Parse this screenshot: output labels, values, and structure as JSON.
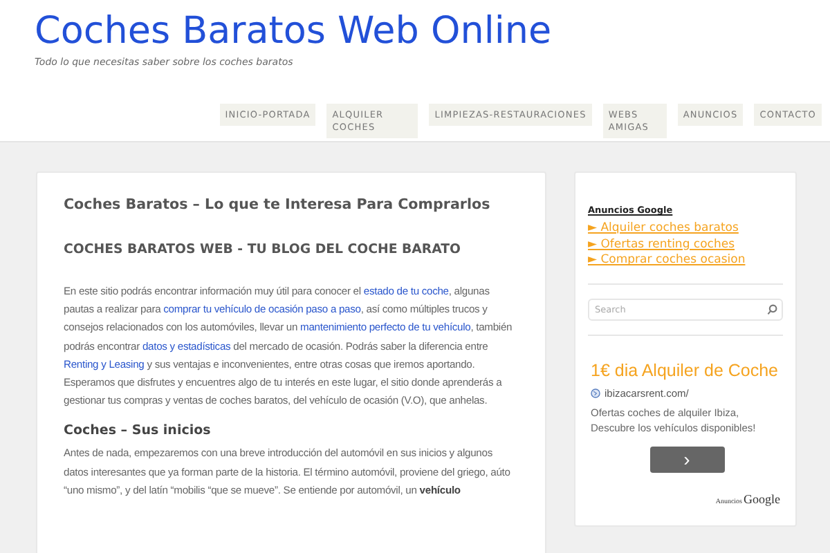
{
  "site": {
    "title": "Coches Baratos Web Online",
    "tagline": "Todo lo que necesitas saber sobre los coches baratos"
  },
  "nav": {
    "items": [
      {
        "label": "INICIO-PORTADA"
      },
      {
        "label": "ALQUILER COCHES"
      },
      {
        "label": "LIMPIEZAS-RESTAURACIONES"
      },
      {
        "label": "WEBS AMIGAS"
      },
      {
        "label": "ANUNCIOS"
      },
      {
        "label": "CONTACTO"
      }
    ]
  },
  "post": {
    "title": "Coches Baratos – Lo que te Interesa Para Comprarlos",
    "blocks": [
      {
        "kind": "heading",
        "text": "COCHES BARATOS WEB - TU BLOG DEL COCHE BARATO"
      },
      {
        "kind": "paragraph",
        "segments": [
          {
            "kind": "text",
            "text": "En este sitio podrás encontrar información muy útil para conocer el "
          },
          {
            "kind": "link",
            "text": "estado de tu coche"
          },
          {
            "kind": "text",
            "text": ", algunas pautas a realizar para "
          },
          {
            "kind": "link",
            "text": "comprar tu vehículo de ocasión paso a paso"
          },
          {
            "kind": "text",
            "text": ", así como múltiples trucos y consejos relacionados con los automóviles, llevar un "
          },
          {
            "kind": "link",
            "text": "mantenimiento perfecto de tu vehículo"
          },
          {
            "kind": "text",
            "text": ", también podrás encontrar "
          },
          {
            "kind": "link",
            "text": "datos y estadísticas"
          },
          {
            "kind": "text",
            "text": " del mercado de ocasión. Podrás saber la diferencia entre "
          },
          {
            "kind": "link",
            "text": "Renting y Leasing"
          },
          {
            "kind": "text",
            "text": " y sus ventajas e inconvenientes, entre otras cosas que iremos aportando. Esperamos que disfrutes y encuentres algo de tu interés en este lugar, el sitio donde aprenderás a gestionar tus compras y ventas de coches baratos, del vehículo de ocasión (V.O), que anhelas."
          }
        ]
      },
      {
        "kind": "subheading",
        "text": "Coches – Sus inicios"
      },
      {
        "kind": "paragraph",
        "segments": [
          {
            "kind": "text",
            "text": "Antes de nada, empezaremos con una breve introducción del automóvil en sus inicios y algunos datos interesantes que ya forman parte de la historia.  El término automóvil, proviene del griego, aúto  “uno mismo”, y del latín “mobilis “que se mueve”.  Se entiende por automóvil, un **vehículo**"
          }
        ]
      }
    ]
  },
  "sidebar": {
    "ads_label": "Anuncios Google",
    "ad_links": [
      {
        "marker": "►",
        "text": "Alquiler coches baratos"
      },
      {
        "marker": "►",
        "text": "Ofertas renting coches"
      },
      {
        "marker": "►",
        "text": "Comprar coches ocasion"
      }
    ],
    "search": {
      "placeholder": "Search"
    },
    "ad": {
      "headline": "1€ dia Alquiler de Coche",
      "url": "ibizacarsrent.com/",
      "description": "Ofertas coches de alquiler Ibiza, Descubre los vehículos disponibles!",
      "button": "›",
      "footer_prefix": "Anuncios",
      "footer_brand": "Google"
    }
  }
}
